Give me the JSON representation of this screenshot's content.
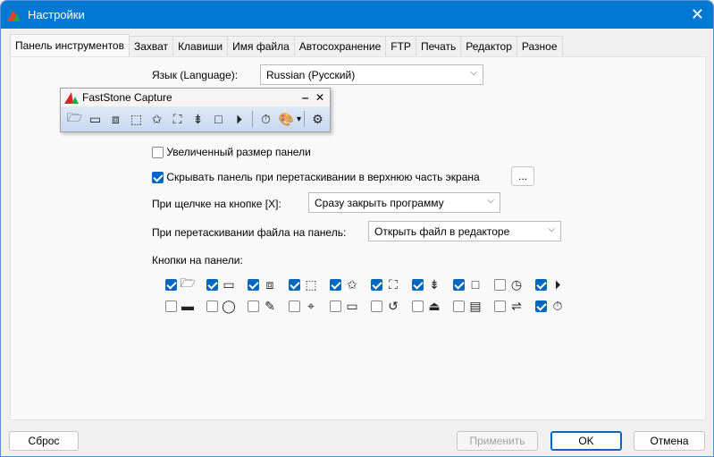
{
  "window": {
    "title": "Настройки",
    "close": "✕"
  },
  "tabs": [
    "Панель инструментов",
    "Захват",
    "Клавиши",
    "Имя файла",
    "Автосохранение",
    "FTP",
    "Печать",
    "Редактор",
    "Разное"
  ],
  "language": {
    "label": "Язык (Language):",
    "value": "Russian (Русский)"
  },
  "preview": {
    "title": "FastStone Capture",
    "minimize": "‒",
    "close": "✕",
    "icons": [
      [
        "open-folder-icon",
        "🗁"
      ],
      [
        "window-icon",
        "▭"
      ],
      [
        "object-icon",
        "⧈"
      ],
      [
        "rectangle-region-icon",
        "⬚"
      ],
      [
        "freehand-region-icon",
        "✩"
      ],
      [
        "fullscreen-icon",
        "⛶"
      ],
      [
        "scrolling-window-icon",
        "⇟"
      ],
      [
        "fixed-region-icon",
        "□"
      ],
      [
        "screen-recorder-icon",
        "⏵"
      ]
    ],
    "timer": "⏱",
    "palette": "🎨",
    "arrow": "▾",
    "settings": "⚙"
  },
  "options": {
    "large_panel": {
      "label": "Увеличенный размер панели",
      "checked": false
    },
    "hide_panel": {
      "label": "Скрывать панель при перетаскивании в верхнюю часть экрана",
      "checked": true,
      "button": "..."
    },
    "close_click": {
      "label": "При щелчке на кнопке [X]:",
      "value": "Сразу закрыть программу"
    },
    "drag_file": {
      "label": "При перетаскивании файла на панель:",
      "value": "Открыть файл в редакторе"
    }
  },
  "panel_buttons": {
    "label": "Кнопки на панели:",
    "row1": [
      [
        "open-icon",
        "🗁",
        true
      ],
      [
        "window-icon",
        "▭",
        true
      ],
      [
        "object-icon",
        "⧈",
        true
      ],
      [
        "rectangle-icon",
        "⬚",
        true
      ],
      [
        "freehand-icon",
        "✩",
        true
      ],
      [
        "fullscreen-icon",
        "⛶",
        true
      ],
      [
        "scrolling-icon",
        "⇟",
        true
      ],
      [
        "fixed-region-icon",
        "□",
        true
      ],
      [
        "delay-icon",
        "◷",
        false
      ],
      [
        "recorder-icon",
        "⏵",
        true
      ]
    ],
    "row2": [
      [
        "screen-bar-icon",
        "▬",
        false
      ],
      [
        "magnifier-icon",
        "◯",
        false
      ],
      [
        "color-picker-icon",
        "✎",
        false
      ],
      [
        "crosshair-icon",
        "⌖",
        false
      ],
      [
        "ruler-icon",
        "▭",
        false
      ],
      [
        "undo-icon",
        "↺",
        false
      ],
      [
        "scanner-icon",
        "⏏",
        false
      ],
      [
        "pdf-icon",
        "▤",
        false
      ],
      [
        "compare-icon",
        "⇌",
        false
      ],
      [
        "timer-icon",
        "⏱",
        true
      ]
    ]
  },
  "buttons": {
    "reset": "Сброс",
    "apply": "Применить",
    "ok": "OK",
    "cancel": "Отмена"
  }
}
